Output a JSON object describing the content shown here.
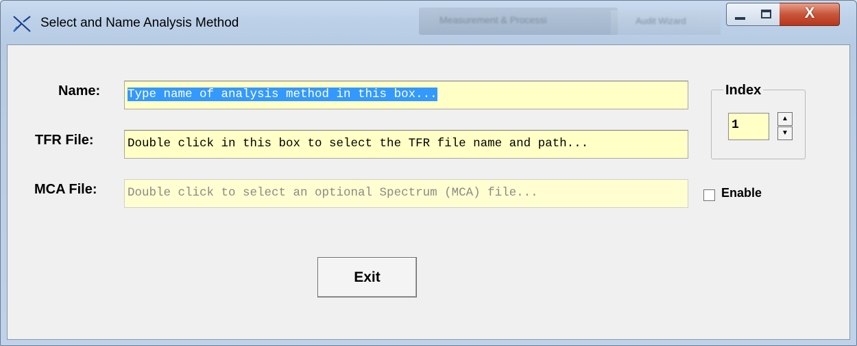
{
  "window": {
    "title": "Select and Name Analysis Method",
    "background_tab_1": "Measurement & Processi",
    "background_tab_2": "Audit Wizard",
    "close_glyph": "X"
  },
  "form": {
    "name_label": "Name:",
    "name_value": "Type name of analysis method in this box...",
    "tfr_label": "TFR File:",
    "tfr_value": "Double click in this box to select the TFR file name and path...",
    "mca_label": "MCA File:",
    "mca_placeholder": "Double click to select an optional Spectrum (MCA) file...",
    "index_label": "Index",
    "index_value": "1",
    "spin_up": "▲",
    "spin_down": "▼",
    "enable_label": "Enable",
    "enable_checked": false,
    "exit_label": "Exit"
  },
  "colors": {
    "field_bg": "#ffffc6",
    "selection": "#3399ff",
    "close_button": "#c7553a"
  }
}
